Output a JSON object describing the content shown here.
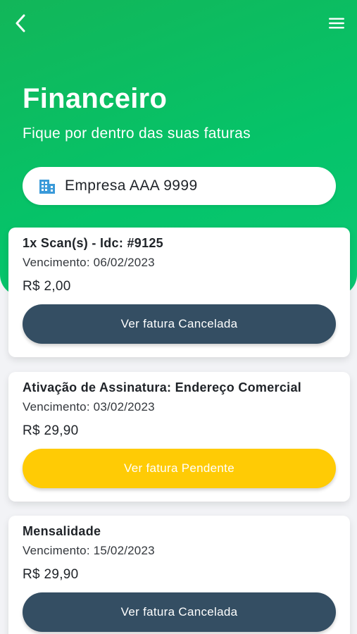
{
  "header": {
    "title": "Financeiro",
    "subtitle": "Fique por dentro das suas faturas",
    "back_icon": "chevron-left-icon",
    "menu_icon": "hamburger-menu-icon"
  },
  "company": {
    "icon": "building-icon",
    "name": "Empresa AAA 9999"
  },
  "invoices": [
    {
      "title": "1x Scan(s) - Idc: #9125",
      "due": "Vencimento: 06/02/2023",
      "value": "R$ 2,00",
      "button_label": "Ver fatura Cancelada",
      "status": "cancelada"
    },
    {
      "title": "Ativação de Assinatura: Endereço Comercial",
      "due": "Vencimento: 03/02/2023",
      "value": "R$ 29,90",
      "button_label": "Ver fatura Pendente",
      "status": "pendente"
    },
    {
      "title": "Mensalidade",
      "due": "Vencimento: 15/02/2023",
      "value": "R$ 29,90",
      "button_label": "Ver fatura Cancelada",
      "status": "cancelada"
    }
  ],
  "colors": {
    "brand_green": "#05c46a",
    "cancelled_button": "#344e63",
    "pending_button": "#ffcb05",
    "building_icon": "#3a9ad9"
  }
}
